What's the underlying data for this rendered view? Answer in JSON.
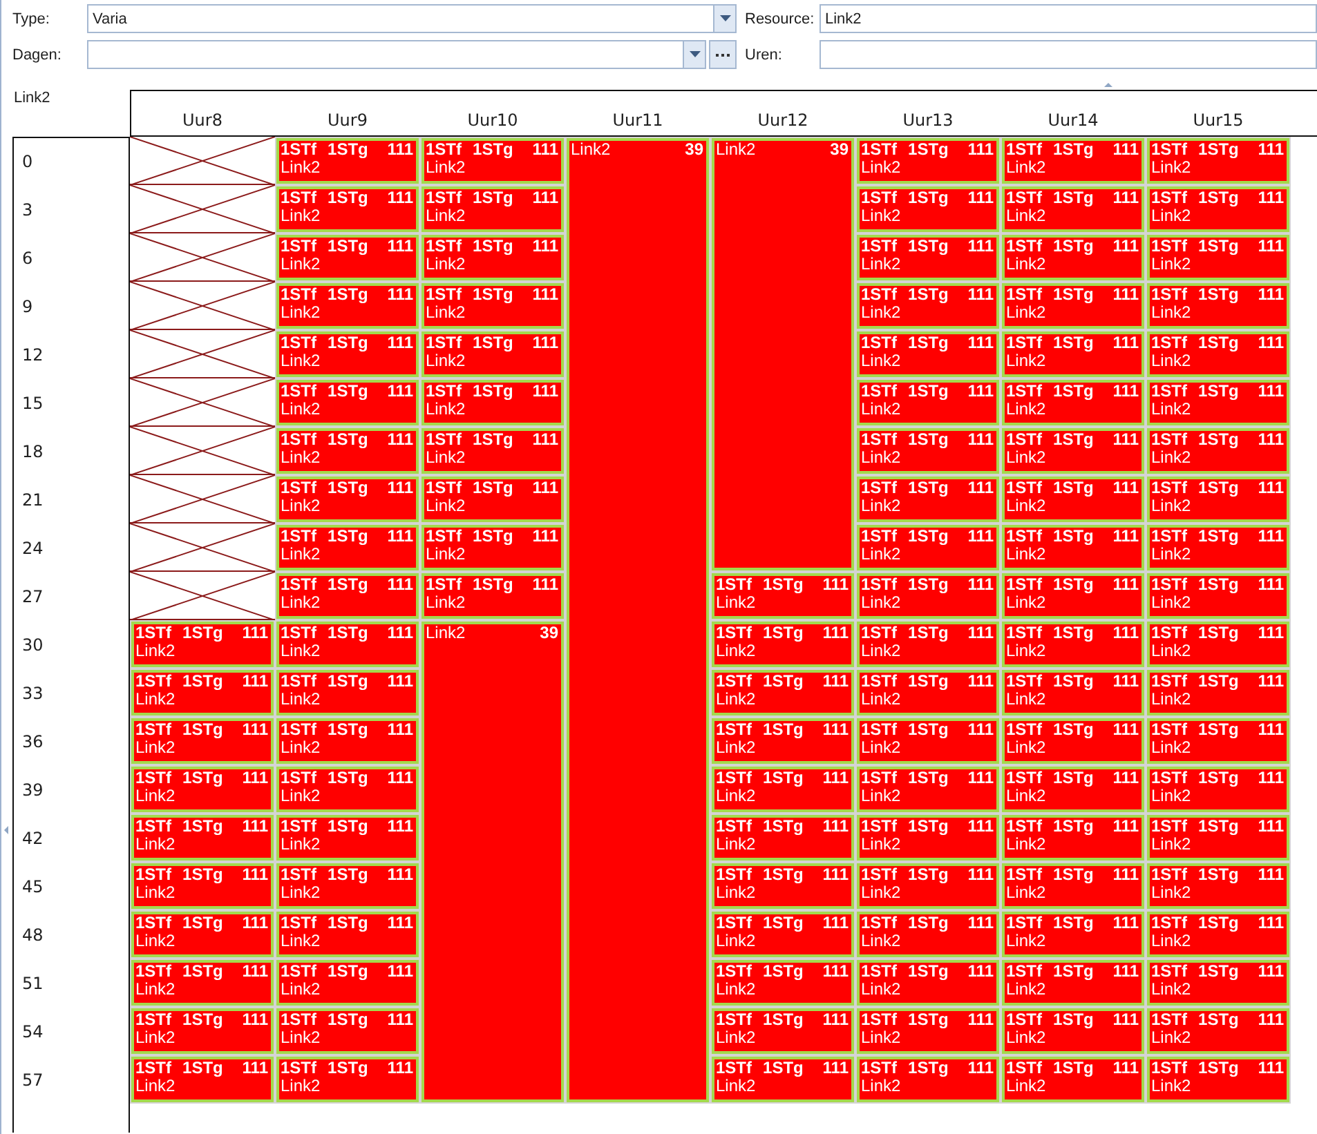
{
  "filter_form": {
    "type": {
      "label": "Type:",
      "value": "Varia"
    },
    "resource": {
      "label": "Resource:",
      "value": "Link2"
    },
    "days": {
      "label": "Dagen:"
    },
    "hours": {
      "label": "Uren:"
    }
  },
  "schedule": {
    "title": "Link2",
    "row_labels": [
      "0",
      "3",
      "6",
      "9",
      "12",
      "15",
      "18",
      "21",
      "24",
      "27",
      "30",
      "33",
      "36",
      "39",
      "42",
      "45",
      "48",
      "51",
      "54",
      "57"
    ],
    "columns": [
      {
        "header": "Uur8",
        "cells": [
          {
            "kind": "blocked"
          },
          {
            "kind": "blocked"
          },
          {
            "kind": "blocked"
          },
          {
            "kind": "blocked"
          },
          {
            "kind": "blocked"
          },
          {
            "kind": "blocked"
          },
          {
            "kind": "blocked"
          },
          {
            "kind": "blocked"
          },
          {
            "kind": "blocked"
          },
          {
            "kind": "blocked"
          },
          {
            "kind": "slot",
            "code_1": "1STf",
            "code_2": "1STg",
            "count": "111",
            "resource": "Link2"
          },
          {
            "kind": "slot",
            "code_1": "1STf",
            "code_2": "1STg",
            "count": "111",
            "resource": "Link2"
          },
          {
            "kind": "slot",
            "code_1": "1STf",
            "code_2": "1STg",
            "count": "111",
            "resource": "Link2"
          },
          {
            "kind": "slot",
            "code_1": "1STf",
            "code_2": "1STg",
            "count": "111",
            "resource": "Link2"
          },
          {
            "kind": "slot",
            "code_1": "1STf",
            "code_2": "1STg",
            "count": "111",
            "resource": "Link2"
          },
          {
            "kind": "slot",
            "code_1": "1STf",
            "code_2": "1STg",
            "count": "111",
            "resource": "Link2"
          },
          {
            "kind": "slot",
            "code_1": "1STf",
            "code_2": "1STg",
            "count": "111",
            "resource": "Link2"
          },
          {
            "kind": "slot",
            "code_1": "1STf",
            "code_2": "1STg",
            "count": "111",
            "resource": "Link2"
          },
          {
            "kind": "slot",
            "code_1": "1STf",
            "code_2": "1STg",
            "count": "111",
            "resource": "Link2"
          },
          {
            "kind": "slot",
            "code_1": "1STf",
            "code_2": "1STg",
            "count": "111",
            "resource": "Link2"
          }
        ]
      },
      {
        "header": "Uur9",
        "cells": [
          {
            "kind": "slot",
            "code_1": "1STf",
            "code_2": "1STg",
            "count": "111",
            "resource": "Link2"
          },
          {
            "kind": "slot",
            "code_1": "1STf",
            "code_2": "1STg",
            "count": "111",
            "resource": "Link2"
          },
          {
            "kind": "slot",
            "code_1": "1STf",
            "code_2": "1STg",
            "count": "111",
            "resource": "Link2"
          },
          {
            "kind": "slot",
            "code_1": "1STf",
            "code_2": "1STg",
            "count": "111",
            "resource": "Link2"
          },
          {
            "kind": "slot",
            "code_1": "1STf",
            "code_2": "1STg",
            "count": "111",
            "resource": "Link2"
          },
          {
            "kind": "slot",
            "code_1": "1STf",
            "code_2": "1STg",
            "count": "111",
            "resource": "Link2"
          },
          {
            "kind": "slot",
            "code_1": "1STf",
            "code_2": "1STg",
            "count": "111",
            "resource": "Link2"
          },
          {
            "kind": "slot",
            "code_1": "1STf",
            "code_2": "1STg",
            "count": "111",
            "resource": "Link2"
          },
          {
            "kind": "slot",
            "code_1": "1STf",
            "code_2": "1STg",
            "count": "111",
            "resource": "Link2"
          },
          {
            "kind": "slot",
            "code_1": "1STf",
            "code_2": "1STg",
            "count": "111",
            "resource": "Link2"
          },
          {
            "kind": "slot",
            "code_1": "1STf",
            "code_2": "1STg",
            "count": "111",
            "resource": "Link2"
          },
          {
            "kind": "slot",
            "code_1": "1STf",
            "code_2": "1STg",
            "count": "111",
            "resource": "Link2"
          },
          {
            "kind": "slot",
            "code_1": "1STf",
            "code_2": "1STg",
            "count": "111",
            "resource": "Link2"
          },
          {
            "kind": "slot",
            "code_1": "1STf",
            "code_2": "1STg",
            "count": "111",
            "resource": "Link2"
          },
          {
            "kind": "slot",
            "code_1": "1STf",
            "code_2": "1STg",
            "count": "111",
            "resource": "Link2"
          },
          {
            "kind": "slot",
            "code_1": "1STf",
            "code_2": "1STg",
            "count": "111",
            "resource": "Link2"
          },
          {
            "kind": "slot",
            "code_1": "1STf",
            "code_2": "1STg",
            "count": "111",
            "resource": "Link2"
          },
          {
            "kind": "slot",
            "code_1": "1STf",
            "code_2": "1STg",
            "count": "111",
            "resource": "Link2"
          },
          {
            "kind": "slot",
            "code_1": "1STf",
            "code_2": "1STg",
            "count": "111",
            "resource": "Link2"
          },
          {
            "kind": "slot",
            "code_1": "1STf",
            "code_2": "1STg",
            "count": "111",
            "resource": "Link2"
          }
        ]
      },
      {
        "header": "Uur10",
        "cells": [
          {
            "kind": "slot",
            "code_1": "1STf",
            "code_2": "1STg",
            "count": "111",
            "resource": "Link2"
          },
          {
            "kind": "slot",
            "code_1": "1STf",
            "code_2": "1STg",
            "count": "111",
            "resource": "Link2"
          },
          {
            "kind": "slot",
            "code_1": "1STf",
            "code_2": "1STg",
            "count": "111",
            "resource": "Link2"
          },
          {
            "kind": "slot",
            "code_1": "1STf",
            "code_2": "1STg",
            "count": "111",
            "resource": "Link2"
          },
          {
            "kind": "slot",
            "code_1": "1STf",
            "code_2": "1STg",
            "count": "111",
            "resource": "Link2"
          },
          {
            "kind": "slot",
            "code_1": "1STf",
            "code_2": "1STg",
            "count": "111",
            "resource": "Link2"
          },
          {
            "kind": "slot",
            "code_1": "1STf",
            "code_2": "1STg",
            "count": "111",
            "resource": "Link2"
          },
          {
            "kind": "slot",
            "code_1": "1STf",
            "code_2": "1STg",
            "count": "111",
            "resource": "Link2"
          },
          {
            "kind": "slot",
            "code_1": "1STf",
            "code_2": "1STg",
            "count": "111",
            "resource": "Link2"
          },
          {
            "kind": "slot",
            "code_1": "1STf",
            "code_2": "1STg",
            "count": "111",
            "resource": "Link2"
          },
          {
            "kind": "merged",
            "label": "Link2",
            "count": "39"
          },
          {
            "kind": "continued"
          },
          {
            "kind": "continued"
          },
          {
            "kind": "continued"
          },
          {
            "kind": "continued"
          },
          {
            "kind": "continued"
          },
          {
            "kind": "continued"
          },
          {
            "kind": "continued"
          },
          {
            "kind": "continued"
          },
          {
            "kind": "continued"
          }
        ]
      },
      {
        "header": "Uur11",
        "cells": [
          {
            "kind": "merged",
            "label": "Link2",
            "count": "39"
          },
          {
            "kind": "continued"
          },
          {
            "kind": "continued"
          },
          {
            "kind": "continued"
          },
          {
            "kind": "continued"
          },
          {
            "kind": "continued"
          },
          {
            "kind": "continued"
          },
          {
            "kind": "continued"
          },
          {
            "kind": "continued"
          },
          {
            "kind": "continued"
          },
          {
            "kind": "continued"
          },
          {
            "kind": "continued"
          },
          {
            "kind": "continued"
          },
          {
            "kind": "continued"
          },
          {
            "kind": "continued"
          },
          {
            "kind": "continued"
          },
          {
            "kind": "continued"
          },
          {
            "kind": "continued"
          },
          {
            "kind": "continued"
          },
          {
            "kind": "continued"
          }
        ]
      },
      {
        "header": "Uur12",
        "cells": [
          {
            "kind": "merged",
            "label": "Link2",
            "count": "39"
          },
          {
            "kind": "continued"
          },
          {
            "kind": "continued"
          },
          {
            "kind": "continued"
          },
          {
            "kind": "continued"
          },
          {
            "kind": "continued"
          },
          {
            "kind": "continued"
          },
          {
            "kind": "continued"
          },
          {
            "kind": "continued"
          },
          {
            "kind": "slot",
            "code_1": "1STf",
            "code_2": "1STg",
            "count": "111",
            "resource": "Link2"
          },
          {
            "kind": "slot",
            "code_1": "1STf",
            "code_2": "1STg",
            "count": "111",
            "resource": "Link2"
          },
          {
            "kind": "slot",
            "code_1": "1STf",
            "code_2": "1STg",
            "count": "111",
            "resource": "Link2"
          },
          {
            "kind": "slot",
            "code_1": "1STf",
            "code_2": "1STg",
            "count": "111",
            "resource": "Link2"
          },
          {
            "kind": "slot",
            "code_1": "1STf",
            "code_2": "1STg",
            "count": "111",
            "resource": "Link2"
          },
          {
            "kind": "slot",
            "code_1": "1STf",
            "code_2": "1STg",
            "count": "111",
            "resource": "Link2"
          },
          {
            "kind": "slot",
            "code_1": "1STf",
            "code_2": "1STg",
            "count": "111",
            "resource": "Link2"
          },
          {
            "kind": "slot",
            "code_1": "1STf",
            "code_2": "1STg",
            "count": "111",
            "resource": "Link2"
          },
          {
            "kind": "slot",
            "code_1": "1STf",
            "code_2": "1STg",
            "count": "111",
            "resource": "Link2"
          },
          {
            "kind": "slot",
            "code_1": "1STf",
            "code_2": "1STg",
            "count": "111",
            "resource": "Link2"
          },
          {
            "kind": "slot",
            "code_1": "1STf",
            "code_2": "1STg",
            "count": "111",
            "resource": "Link2"
          }
        ]
      },
      {
        "header": "Uur13",
        "cells": [
          {
            "kind": "slot",
            "code_1": "1STf",
            "code_2": "1STg",
            "count": "111",
            "resource": "Link2"
          },
          {
            "kind": "slot",
            "code_1": "1STf",
            "code_2": "1STg",
            "count": "111",
            "resource": "Link2"
          },
          {
            "kind": "slot",
            "code_1": "1STf",
            "code_2": "1STg",
            "count": "111",
            "resource": "Link2"
          },
          {
            "kind": "slot",
            "code_1": "1STf",
            "code_2": "1STg",
            "count": "111",
            "resource": "Link2"
          },
          {
            "kind": "slot",
            "code_1": "1STf",
            "code_2": "1STg",
            "count": "111",
            "resource": "Link2"
          },
          {
            "kind": "slot",
            "code_1": "1STf",
            "code_2": "1STg",
            "count": "111",
            "resource": "Link2"
          },
          {
            "kind": "slot",
            "code_1": "1STf",
            "code_2": "1STg",
            "count": "111",
            "resource": "Link2"
          },
          {
            "kind": "slot",
            "code_1": "1STf",
            "code_2": "1STg",
            "count": "111",
            "resource": "Link2"
          },
          {
            "kind": "slot",
            "code_1": "1STf",
            "code_2": "1STg",
            "count": "111",
            "resource": "Link2"
          },
          {
            "kind": "slot",
            "code_1": "1STf",
            "code_2": "1STg",
            "count": "111",
            "resource": "Link2"
          },
          {
            "kind": "slot",
            "code_1": "1STf",
            "code_2": "1STg",
            "count": "111",
            "resource": "Link2"
          },
          {
            "kind": "slot",
            "code_1": "1STf",
            "code_2": "1STg",
            "count": "111",
            "resource": "Link2"
          },
          {
            "kind": "slot",
            "code_1": "1STf",
            "code_2": "1STg",
            "count": "111",
            "resource": "Link2"
          },
          {
            "kind": "slot",
            "code_1": "1STf",
            "code_2": "1STg",
            "count": "111",
            "resource": "Link2"
          },
          {
            "kind": "slot",
            "code_1": "1STf",
            "code_2": "1STg",
            "count": "111",
            "resource": "Link2"
          },
          {
            "kind": "slot",
            "code_1": "1STf",
            "code_2": "1STg",
            "count": "111",
            "resource": "Link2"
          },
          {
            "kind": "slot",
            "code_1": "1STf",
            "code_2": "1STg",
            "count": "111",
            "resource": "Link2"
          },
          {
            "kind": "slot",
            "code_1": "1STf",
            "code_2": "1STg",
            "count": "111",
            "resource": "Link2"
          },
          {
            "kind": "slot",
            "code_1": "1STf",
            "code_2": "1STg",
            "count": "111",
            "resource": "Link2"
          },
          {
            "kind": "slot",
            "code_1": "1STf",
            "code_2": "1STg",
            "count": "111",
            "resource": "Link2"
          }
        ]
      },
      {
        "header": "Uur14",
        "cells": [
          {
            "kind": "slot",
            "code_1": "1STf",
            "code_2": "1STg",
            "count": "111",
            "resource": "Link2"
          },
          {
            "kind": "slot",
            "code_1": "1STf",
            "code_2": "1STg",
            "count": "111",
            "resource": "Link2"
          },
          {
            "kind": "slot",
            "code_1": "1STf",
            "code_2": "1STg",
            "count": "111",
            "resource": "Link2"
          },
          {
            "kind": "slot",
            "code_1": "1STf",
            "code_2": "1STg",
            "count": "111",
            "resource": "Link2"
          },
          {
            "kind": "slot",
            "code_1": "1STf",
            "code_2": "1STg",
            "count": "111",
            "resource": "Link2"
          },
          {
            "kind": "slot",
            "code_1": "1STf",
            "code_2": "1STg",
            "count": "111",
            "resource": "Link2"
          },
          {
            "kind": "slot",
            "code_1": "1STf",
            "code_2": "1STg",
            "count": "111",
            "resource": "Link2"
          },
          {
            "kind": "slot",
            "code_1": "1STf",
            "code_2": "1STg",
            "count": "111",
            "resource": "Link2"
          },
          {
            "kind": "slot",
            "code_1": "1STf",
            "code_2": "1STg",
            "count": "111",
            "resource": "Link2"
          },
          {
            "kind": "slot",
            "code_1": "1STf",
            "code_2": "1STg",
            "count": "111",
            "resource": "Link2"
          },
          {
            "kind": "slot",
            "code_1": "1STf",
            "code_2": "1STg",
            "count": "111",
            "resource": "Link2"
          },
          {
            "kind": "slot",
            "code_1": "1STf",
            "code_2": "1STg",
            "count": "111",
            "resource": "Link2"
          },
          {
            "kind": "slot",
            "code_1": "1STf",
            "code_2": "1STg",
            "count": "111",
            "resource": "Link2"
          },
          {
            "kind": "slot",
            "code_1": "1STf",
            "code_2": "1STg",
            "count": "111",
            "resource": "Link2"
          },
          {
            "kind": "slot",
            "code_1": "1STf",
            "code_2": "1STg",
            "count": "111",
            "resource": "Link2"
          },
          {
            "kind": "slot",
            "code_1": "1STf",
            "code_2": "1STg",
            "count": "111",
            "resource": "Link2"
          },
          {
            "kind": "slot",
            "code_1": "1STf",
            "code_2": "1STg",
            "count": "111",
            "resource": "Link2"
          },
          {
            "kind": "slot",
            "code_1": "1STf",
            "code_2": "1STg",
            "count": "111",
            "resource": "Link2"
          },
          {
            "kind": "slot",
            "code_1": "1STf",
            "code_2": "1STg",
            "count": "111",
            "resource": "Link2"
          },
          {
            "kind": "slot",
            "code_1": "1STf",
            "code_2": "1STg",
            "count": "111",
            "resource": "Link2"
          }
        ]
      },
      {
        "header": "Uur15",
        "cells": [
          {
            "kind": "slot",
            "code_1": "1STf",
            "code_2": "1STg",
            "count": "111",
            "resource": "Link2"
          },
          {
            "kind": "slot",
            "code_1": "1STf",
            "code_2": "1STg",
            "count": "111",
            "resource": "Link2"
          },
          {
            "kind": "slot",
            "code_1": "1STf",
            "code_2": "1STg",
            "count": "111",
            "resource": "Link2"
          },
          {
            "kind": "slot",
            "code_1": "1STf",
            "code_2": "1STg",
            "count": "111",
            "resource": "Link2"
          },
          {
            "kind": "slot",
            "code_1": "1STf",
            "code_2": "1STg",
            "count": "111",
            "resource": "Link2"
          },
          {
            "kind": "slot",
            "code_1": "1STf",
            "code_2": "1STg",
            "count": "111",
            "resource": "Link2"
          },
          {
            "kind": "slot",
            "code_1": "1STf",
            "code_2": "1STg",
            "count": "111",
            "resource": "Link2"
          },
          {
            "kind": "slot",
            "code_1": "1STf",
            "code_2": "1STg",
            "count": "111",
            "resource": "Link2"
          },
          {
            "kind": "slot",
            "code_1": "1STf",
            "code_2": "1STg",
            "count": "111",
            "resource": "Link2"
          },
          {
            "kind": "slot",
            "code_1": "1STf",
            "code_2": "1STg",
            "count": "111",
            "resource": "Link2"
          },
          {
            "kind": "slot",
            "code_1": "1STf",
            "code_2": "1STg",
            "count": "111",
            "resource": "Link2"
          },
          {
            "kind": "slot",
            "code_1": "1STf",
            "code_2": "1STg",
            "count": "111",
            "resource": "Link2"
          },
          {
            "kind": "slot",
            "code_1": "1STf",
            "code_2": "1STg",
            "count": "111",
            "resource": "Link2"
          },
          {
            "kind": "slot",
            "code_1": "1STf",
            "code_2": "1STg",
            "count": "111",
            "resource": "Link2"
          },
          {
            "kind": "slot",
            "code_1": "1STf",
            "code_2": "1STg",
            "count": "111",
            "resource": "Link2"
          },
          {
            "kind": "slot",
            "code_1": "1STf",
            "code_2": "1STg",
            "count": "111",
            "resource": "Link2"
          },
          {
            "kind": "slot",
            "code_1": "1STf",
            "code_2": "1STg",
            "count": "111",
            "resource": "Link2"
          },
          {
            "kind": "slot",
            "code_1": "1STf",
            "code_2": "1STg",
            "count": "111",
            "resource": "Link2"
          },
          {
            "kind": "slot",
            "code_1": "1STf",
            "code_2": "1STg",
            "count": "111",
            "resource": "Link2"
          },
          {
            "kind": "slot",
            "code_1": "1STf",
            "code_2": "1STg",
            "count": "111",
            "resource": "Link2"
          }
        ]
      }
    ]
  }
}
